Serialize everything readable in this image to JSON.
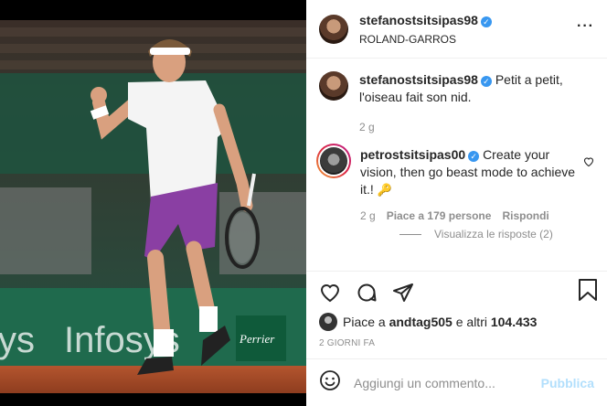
{
  "post": {
    "author": "stefanostsitsipas98",
    "location": "ROLAND-GARROS",
    "more_icon": "three-dots-icon"
  },
  "caption": {
    "user": "stefanostsitsipas98",
    "text": "Petit a petit, l'oiseau fait son nid.",
    "time": "2 g"
  },
  "comment": {
    "user": "petrostsitsipas00",
    "text": "Create your vision, then go beast mode to achieve it.!",
    "emoji": "🔑",
    "time": "2 g",
    "likes": "Piace a 179 persone",
    "reply": "Rispondi",
    "view_replies": "Visualizza le risposte (2)"
  },
  "likes": {
    "prefix": "Piace a",
    "user": "andtag505",
    "suffix": "e altri",
    "count": "104.433"
  },
  "date": "2 GIORNI FA",
  "add_comment": {
    "placeholder": "Aggiungi un commento...",
    "post_label": "Pubblica"
  },
  "photo": {
    "banner_text": "Infosys",
    "banner_text_left": "ys",
    "sponsor": "Perrier"
  }
}
